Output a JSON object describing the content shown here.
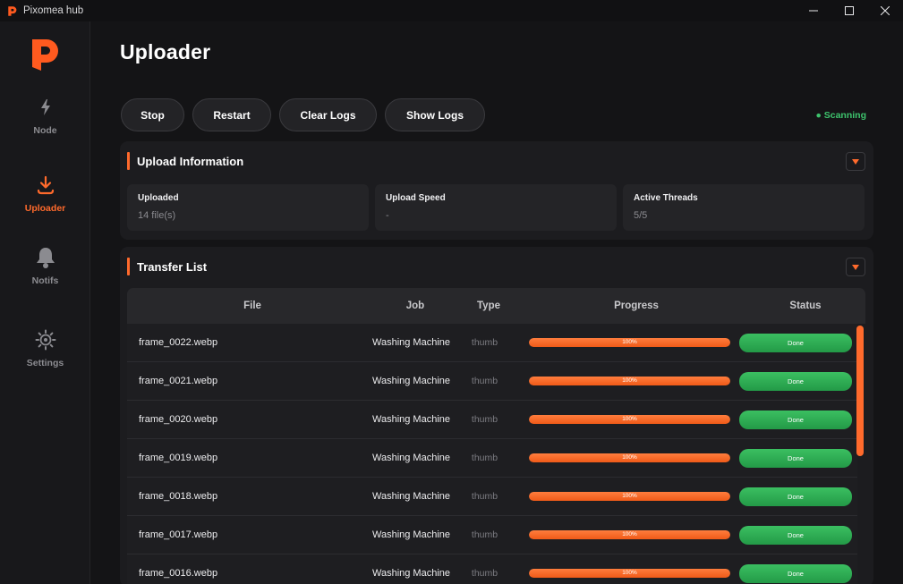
{
  "window": {
    "title": "Pixomea hub"
  },
  "sidebar": {
    "items": [
      {
        "label": "Node",
        "icon": "bolt-icon",
        "active": false
      },
      {
        "label": "Uploader",
        "icon": "download-icon",
        "active": true
      },
      {
        "label": "Notifs",
        "icon": "bell-icon",
        "active": false
      },
      {
        "label": "Settings",
        "icon": "gear-icon",
        "active": false
      }
    ]
  },
  "page": {
    "title": "Uploader"
  },
  "toolbar": {
    "stop_label": "Stop",
    "restart_label": "Restart",
    "clear_logs_label": "Clear Logs",
    "show_logs_label": "Show Logs",
    "status": "● Scanning"
  },
  "upload_info": {
    "title": "Upload Information",
    "stats": [
      {
        "label": "Uploaded",
        "value": "14 file(s)"
      },
      {
        "label": "Upload Speed",
        "value": "-"
      },
      {
        "label": "Active Threads",
        "value": "5/5"
      }
    ]
  },
  "transfer_list": {
    "title": "Transfer List",
    "columns": [
      "File",
      "Job",
      "Type",
      "Progress",
      "Status"
    ],
    "rows": [
      {
        "file": "frame_0022.webp",
        "job": "Washing Machine",
        "type": "thumb",
        "progress": "100%",
        "status": "Done"
      },
      {
        "file": "frame_0021.webp",
        "job": "Washing Machine",
        "type": "thumb",
        "progress": "100%",
        "status": "Done"
      },
      {
        "file": "frame_0020.webp",
        "job": "Washing Machine",
        "type": "thumb",
        "progress": "100%",
        "status": "Done"
      },
      {
        "file": "frame_0019.webp",
        "job": "Washing Machine",
        "type": "thumb",
        "progress": "100%",
        "status": "Done"
      },
      {
        "file": "frame_0018.webp",
        "job": "Washing Machine",
        "type": "thumb",
        "progress": "100%",
        "status": "Done"
      },
      {
        "file": "frame_0017.webp",
        "job": "Washing Machine",
        "type": "thumb",
        "progress": "100%",
        "status": "Done"
      },
      {
        "file": "frame_0016.webp",
        "job": "Washing Machine",
        "type": "thumb",
        "progress": "100%",
        "status": "Done"
      }
    ]
  },
  "colors": {
    "accent": "#ff6a2c",
    "success": "#2eae55",
    "background": "#141416"
  }
}
